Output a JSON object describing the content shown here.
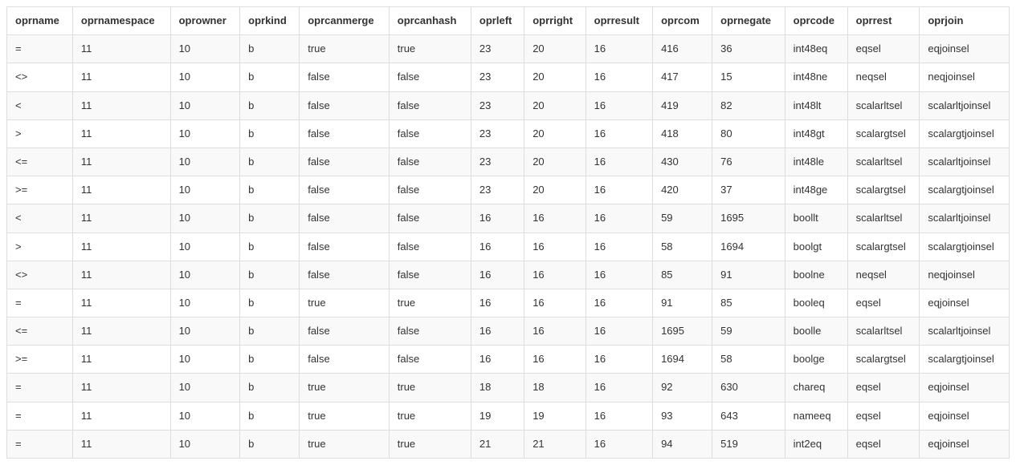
{
  "table": {
    "columns": [
      "oprname",
      "oprnamespace",
      "oprowner",
      "oprkind",
      "oprcanmerge",
      "oprcanhash",
      "oprleft",
      "oprright",
      "oprresult",
      "oprcom",
      "oprnegate",
      "oprcode",
      "oprrest",
      "oprjoin"
    ],
    "rows": [
      {
        "oprname": "=",
        "oprnamespace": "11",
        "oprowner": "10",
        "oprkind": "b",
        "oprcanmerge": "true",
        "oprcanhash": "true",
        "oprleft": "23",
        "oprright": "20",
        "oprresult": "16",
        "oprcom": "416",
        "oprnegate": "36",
        "oprcode": "int48eq",
        "oprrest": "eqsel",
        "oprjoin": "eqjoinsel"
      },
      {
        "oprname": "<>",
        "oprnamespace": "11",
        "oprowner": "10",
        "oprkind": "b",
        "oprcanmerge": "false",
        "oprcanhash": "false",
        "oprleft": "23",
        "oprright": "20",
        "oprresult": "16",
        "oprcom": "417",
        "oprnegate": "15",
        "oprcode": "int48ne",
        "oprrest": "neqsel",
        "oprjoin": "neqjoinsel"
      },
      {
        "oprname": "<",
        "oprnamespace": "11",
        "oprowner": "10",
        "oprkind": "b",
        "oprcanmerge": "false",
        "oprcanhash": "false",
        "oprleft": "23",
        "oprright": "20",
        "oprresult": "16",
        "oprcom": "419",
        "oprnegate": "82",
        "oprcode": "int48lt",
        "oprrest": "scalarltsel",
        "oprjoin": "scalarltjoinsel"
      },
      {
        "oprname": ">",
        "oprnamespace": "11",
        "oprowner": "10",
        "oprkind": "b",
        "oprcanmerge": "false",
        "oprcanhash": "false",
        "oprleft": "23",
        "oprright": "20",
        "oprresult": "16",
        "oprcom": "418",
        "oprnegate": "80",
        "oprcode": "int48gt",
        "oprrest": "scalargtsel",
        "oprjoin": "scalargtjoinsel"
      },
      {
        "oprname": "<=",
        "oprnamespace": "11",
        "oprowner": "10",
        "oprkind": "b",
        "oprcanmerge": "false",
        "oprcanhash": "false",
        "oprleft": "23",
        "oprright": "20",
        "oprresult": "16",
        "oprcom": "430",
        "oprnegate": "76",
        "oprcode": "int48le",
        "oprrest": "scalarltsel",
        "oprjoin": "scalarltjoinsel"
      },
      {
        "oprname": ">=",
        "oprnamespace": "11",
        "oprowner": "10",
        "oprkind": "b",
        "oprcanmerge": "false",
        "oprcanhash": "false",
        "oprleft": "23",
        "oprright": "20",
        "oprresult": "16",
        "oprcom": "420",
        "oprnegate": "37",
        "oprcode": "int48ge",
        "oprrest": "scalargtsel",
        "oprjoin": "scalargtjoinsel"
      },
      {
        "oprname": "<",
        "oprnamespace": "11",
        "oprowner": "10",
        "oprkind": "b",
        "oprcanmerge": "false",
        "oprcanhash": "false",
        "oprleft": "16",
        "oprright": "16",
        "oprresult": "16",
        "oprcom": "59",
        "oprnegate": "1695",
        "oprcode": "boollt",
        "oprrest": "scalarltsel",
        "oprjoin": "scalarltjoinsel"
      },
      {
        "oprname": ">",
        "oprnamespace": "11",
        "oprowner": "10",
        "oprkind": "b",
        "oprcanmerge": "false",
        "oprcanhash": "false",
        "oprleft": "16",
        "oprright": "16",
        "oprresult": "16",
        "oprcom": "58",
        "oprnegate": "1694",
        "oprcode": "boolgt",
        "oprrest": "scalargtsel",
        "oprjoin": "scalargtjoinsel"
      },
      {
        "oprname": "<>",
        "oprnamespace": "11",
        "oprowner": "10",
        "oprkind": "b",
        "oprcanmerge": "false",
        "oprcanhash": "false",
        "oprleft": "16",
        "oprright": "16",
        "oprresult": "16",
        "oprcom": "85",
        "oprnegate": "91",
        "oprcode": "boolne",
        "oprrest": "neqsel",
        "oprjoin": "neqjoinsel"
      },
      {
        "oprname": "=",
        "oprnamespace": "11",
        "oprowner": "10",
        "oprkind": "b",
        "oprcanmerge": "true",
        "oprcanhash": "true",
        "oprleft": "16",
        "oprright": "16",
        "oprresult": "16",
        "oprcom": "91",
        "oprnegate": "85",
        "oprcode": "booleq",
        "oprrest": "eqsel",
        "oprjoin": "eqjoinsel"
      },
      {
        "oprname": "<=",
        "oprnamespace": "11",
        "oprowner": "10",
        "oprkind": "b",
        "oprcanmerge": "false",
        "oprcanhash": "false",
        "oprleft": "16",
        "oprright": "16",
        "oprresult": "16",
        "oprcom": "1695",
        "oprnegate": "59",
        "oprcode": "boolle",
        "oprrest": "scalarltsel",
        "oprjoin": "scalarltjoinsel"
      },
      {
        "oprname": ">=",
        "oprnamespace": "11",
        "oprowner": "10",
        "oprkind": "b",
        "oprcanmerge": "false",
        "oprcanhash": "false",
        "oprleft": "16",
        "oprright": "16",
        "oprresult": "16",
        "oprcom": "1694",
        "oprnegate": "58",
        "oprcode": "boolge",
        "oprrest": "scalargtsel",
        "oprjoin": "scalargtjoinsel"
      },
      {
        "oprname": "=",
        "oprnamespace": "11",
        "oprowner": "10",
        "oprkind": "b",
        "oprcanmerge": "true",
        "oprcanhash": "true",
        "oprleft": "18",
        "oprright": "18",
        "oprresult": "16",
        "oprcom": "92",
        "oprnegate": "630",
        "oprcode": "chareq",
        "oprrest": "eqsel",
        "oprjoin": "eqjoinsel"
      },
      {
        "oprname": "=",
        "oprnamespace": "11",
        "oprowner": "10",
        "oprkind": "b",
        "oprcanmerge": "true",
        "oprcanhash": "true",
        "oprleft": "19",
        "oprright": "19",
        "oprresult": "16",
        "oprcom": "93",
        "oprnegate": "643",
        "oprcode": "nameeq",
        "oprrest": "eqsel",
        "oprjoin": "eqjoinsel"
      },
      {
        "oprname": "=",
        "oprnamespace": "11",
        "oprowner": "10",
        "oprkind": "b",
        "oprcanmerge": "true",
        "oprcanhash": "true",
        "oprleft": "21",
        "oprright": "21",
        "oprresult": "16",
        "oprcom": "94",
        "oprnegate": "519",
        "oprcode": "int2eq",
        "oprrest": "eqsel",
        "oprjoin": "eqjoinsel"
      }
    ]
  }
}
